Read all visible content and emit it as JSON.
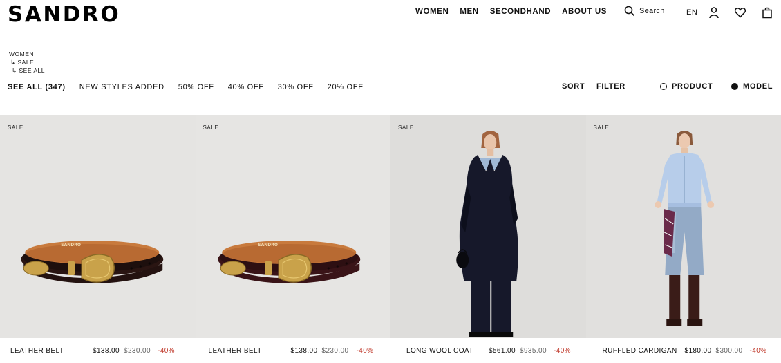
{
  "header": {
    "logo": "SANDRO",
    "nav": [
      "WOMEN",
      "MEN",
      "SECONDHAND",
      "ABOUT US"
    ],
    "search_label": "Search",
    "language": "EN",
    "icons": [
      "search-icon",
      "account-icon",
      "wishlist-heart-icon",
      "shopping-bag-icon"
    ]
  },
  "breadcrumb": [
    "WOMEN",
    "↳ SALE",
    "↳ SEE ALL"
  ],
  "filters": {
    "categories": [
      "SEE ALL (347)",
      "NEW STYLES ADDED",
      "50% OFF",
      "40% OFF",
      "30% OFF",
      "20% OFF"
    ],
    "active": "SEE ALL (347)",
    "sort_label": "SORT",
    "filter_label": "FILTER",
    "view_options": [
      {
        "label": "PRODUCT",
        "selected": false
      },
      {
        "label": "MODEL",
        "selected": true
      }
    ]
  },
  "products": [
    {
      "badge": "SALE",
      "name": "LEATHER BELT",
      "price": "$138.00",
      "original_price": "$230.00",
      "discount": "-40%"
    },
    {
      "badge": "SALE",
      "name": "LEATHER BELT",
      "price": "$138.00",
      "original_price": "$230.00",
      "discount": "-40%"
    },
    {
      "badge": "SALE",
      "name": "LONG WOOL COAT",
      "price": "$561.00",
      "original_price": "$935.00",
      "discount": "-40%"
    },
    {
      "badge": "SALE",
      "name": "RUFFLED CARDIGAN",
      "price": "$180.00",
      "original_price": "$300.00",
      "discount": "-40%"
    }
  ],
  "belt_brand_stamp": "SANDRO",
  "colors": {
    "text": "#111111",
    "discount": "#c0392b",
    "card_background": "#e5e4e2"
  }
}
